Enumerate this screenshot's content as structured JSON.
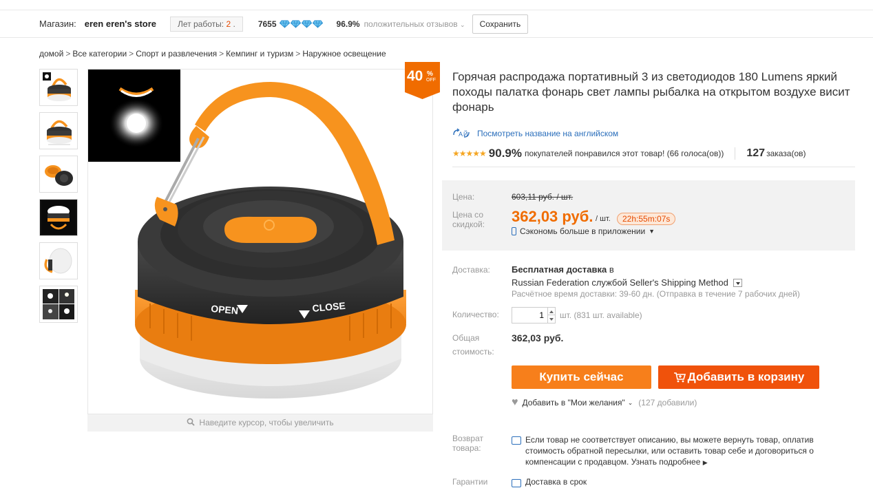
{
  "store": {
    "label": "Магазин:",
    "name": "eren eren's store",
    "years_label": "Лет работы:",
    "years_value": "2",
    "years_suffix": ".",
    "score": "7655",
    "positive_pct": "96.9%",
    "positive_label": "положительных отзывов",
    "save_label": "Сохранить"
  },
  "breadcrumb": [
    "домой",
    "Все категории",
    "Спорт и развлечения",
    "Кемпинг и туризм",
    "Наружное освещение"
  ],
  "gallery": {
    "zoom_hint": "Наведите курсор, чтобы увеличить",
    "badge_number": "40",
    "badge_percent": "%",
    "badge_off": "OFF"
  },
  "product": {
    "title": "Горячая распродажа портативный 3 из светодиодов 180 Lumens яркий походы палатка фонарь свет лампы рыбалка на открытом воздухе висит фонарь",
    "translate_link": "Посмотреть название на английском",
    "rating_pct": "90.9%",
    "rating_text": "покупателей понравился этот товар! (66 голоса(ов))",
    "rating_stars": 4.5,
    "orders_count": "127",
    "orders_label": "заказа(ов)"
  },
  "price": {
    "price_label": "Цена:",
    "old_price": "603,11 руб. / шт.",
    "discount_label_1": "Цена со",
    "discount_label_2": "скидкой:",
    "new_price": "362,03 руб.",
    "per_unit": "/ шт.",
    "timer": "22h:55m:07s",
    "app_save": "Сэкономь больше в приложении"
  },
  "shipping": {
    "label": "Доставка:",
    "free": "Бесплатная доставка",
    "to": "в",
    "method": "Russian Federation службой Seller's Shipping Method",
    "estimate": "Расчётное время доставки: 39-60 дн. (Отправка в течение 7 рабочих дней)"
  },
  "quantity": {
    "label": "Количество:",
    "value": "1",
    "unit": "шт. (831 шт. available)"
  },
  "total": {
    "label_1": "Общая",
    "label_2": "стоимость:",
    "value": "362,03 руб."
  },
  "actions": {
    "buy_now": "Купить сейчас",
    "add_to_cart": "Добавить в корзину",
    "wishlist": "Добавить в \"Мои желания\"",
    "wishlist_count": "(127 добавили)"
  },
  "returns": {
    "label_1": "Возврат",
    "label_2": "товара:",
    "text": "Если товар не соответствует описанию, вы можете вернуть товар, оплатив стоимость обратной пересылки, или оставить товар себе и договориться о компенсации с продавцом.",
    "more": "Узнать подробнее"
  },
  "guarantee": {
    "label": "Гарантии",
    "text": "Доставка в срок"
  },
  "colors": {
    "accent_orange": "#f06c00",
    "buy_button": "#f77f1b",
    "cart_button": "#f0520b",
    "link_blue": "#2a6ebb",
    "star": "#f5a623"
  }
}
